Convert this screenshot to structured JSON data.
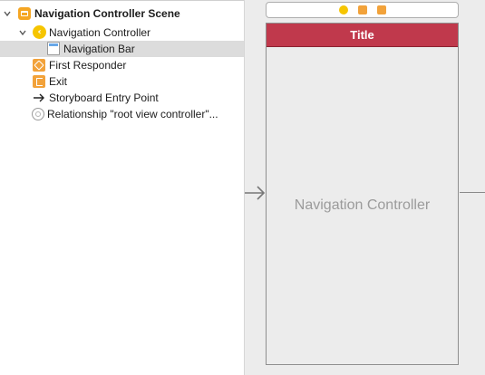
{
  "outline": {
    "scene_title": "Navigation Controller Scene",
    "items": [
      {
        "label": "Navigation Controller",
        "icon": "navigation-controller-icon"
      },
      {
        "label": "Navigation Bar",
        "icon": "navigation-bar-icon",
        "selected": true
      },
      {
        "label": "First Responder",
        "icon": "first-responder-icon"
      },
      {
        "label": "Exit",
        "icon": "exit-icon"
      },
      {
        "label": "Storyboard Entry Point",
        "icon": "entry-arrow-icon"
      },
      {
        "label": "Relationship \"root view controller\"...",
        "icon": "relationship-icon"
      }
    ]
  },
  "canvas": {
    "navbar_title": "Title",
    "controller_label": "Navigation Controller"
  },
  "colors": {
    "navbar_red": "#c0394c",
    "scene_orange": "#f5a623",
    "controller_yellow": "#f6c500",
    "selection_gray": "#dcdcdc"
  }
}
